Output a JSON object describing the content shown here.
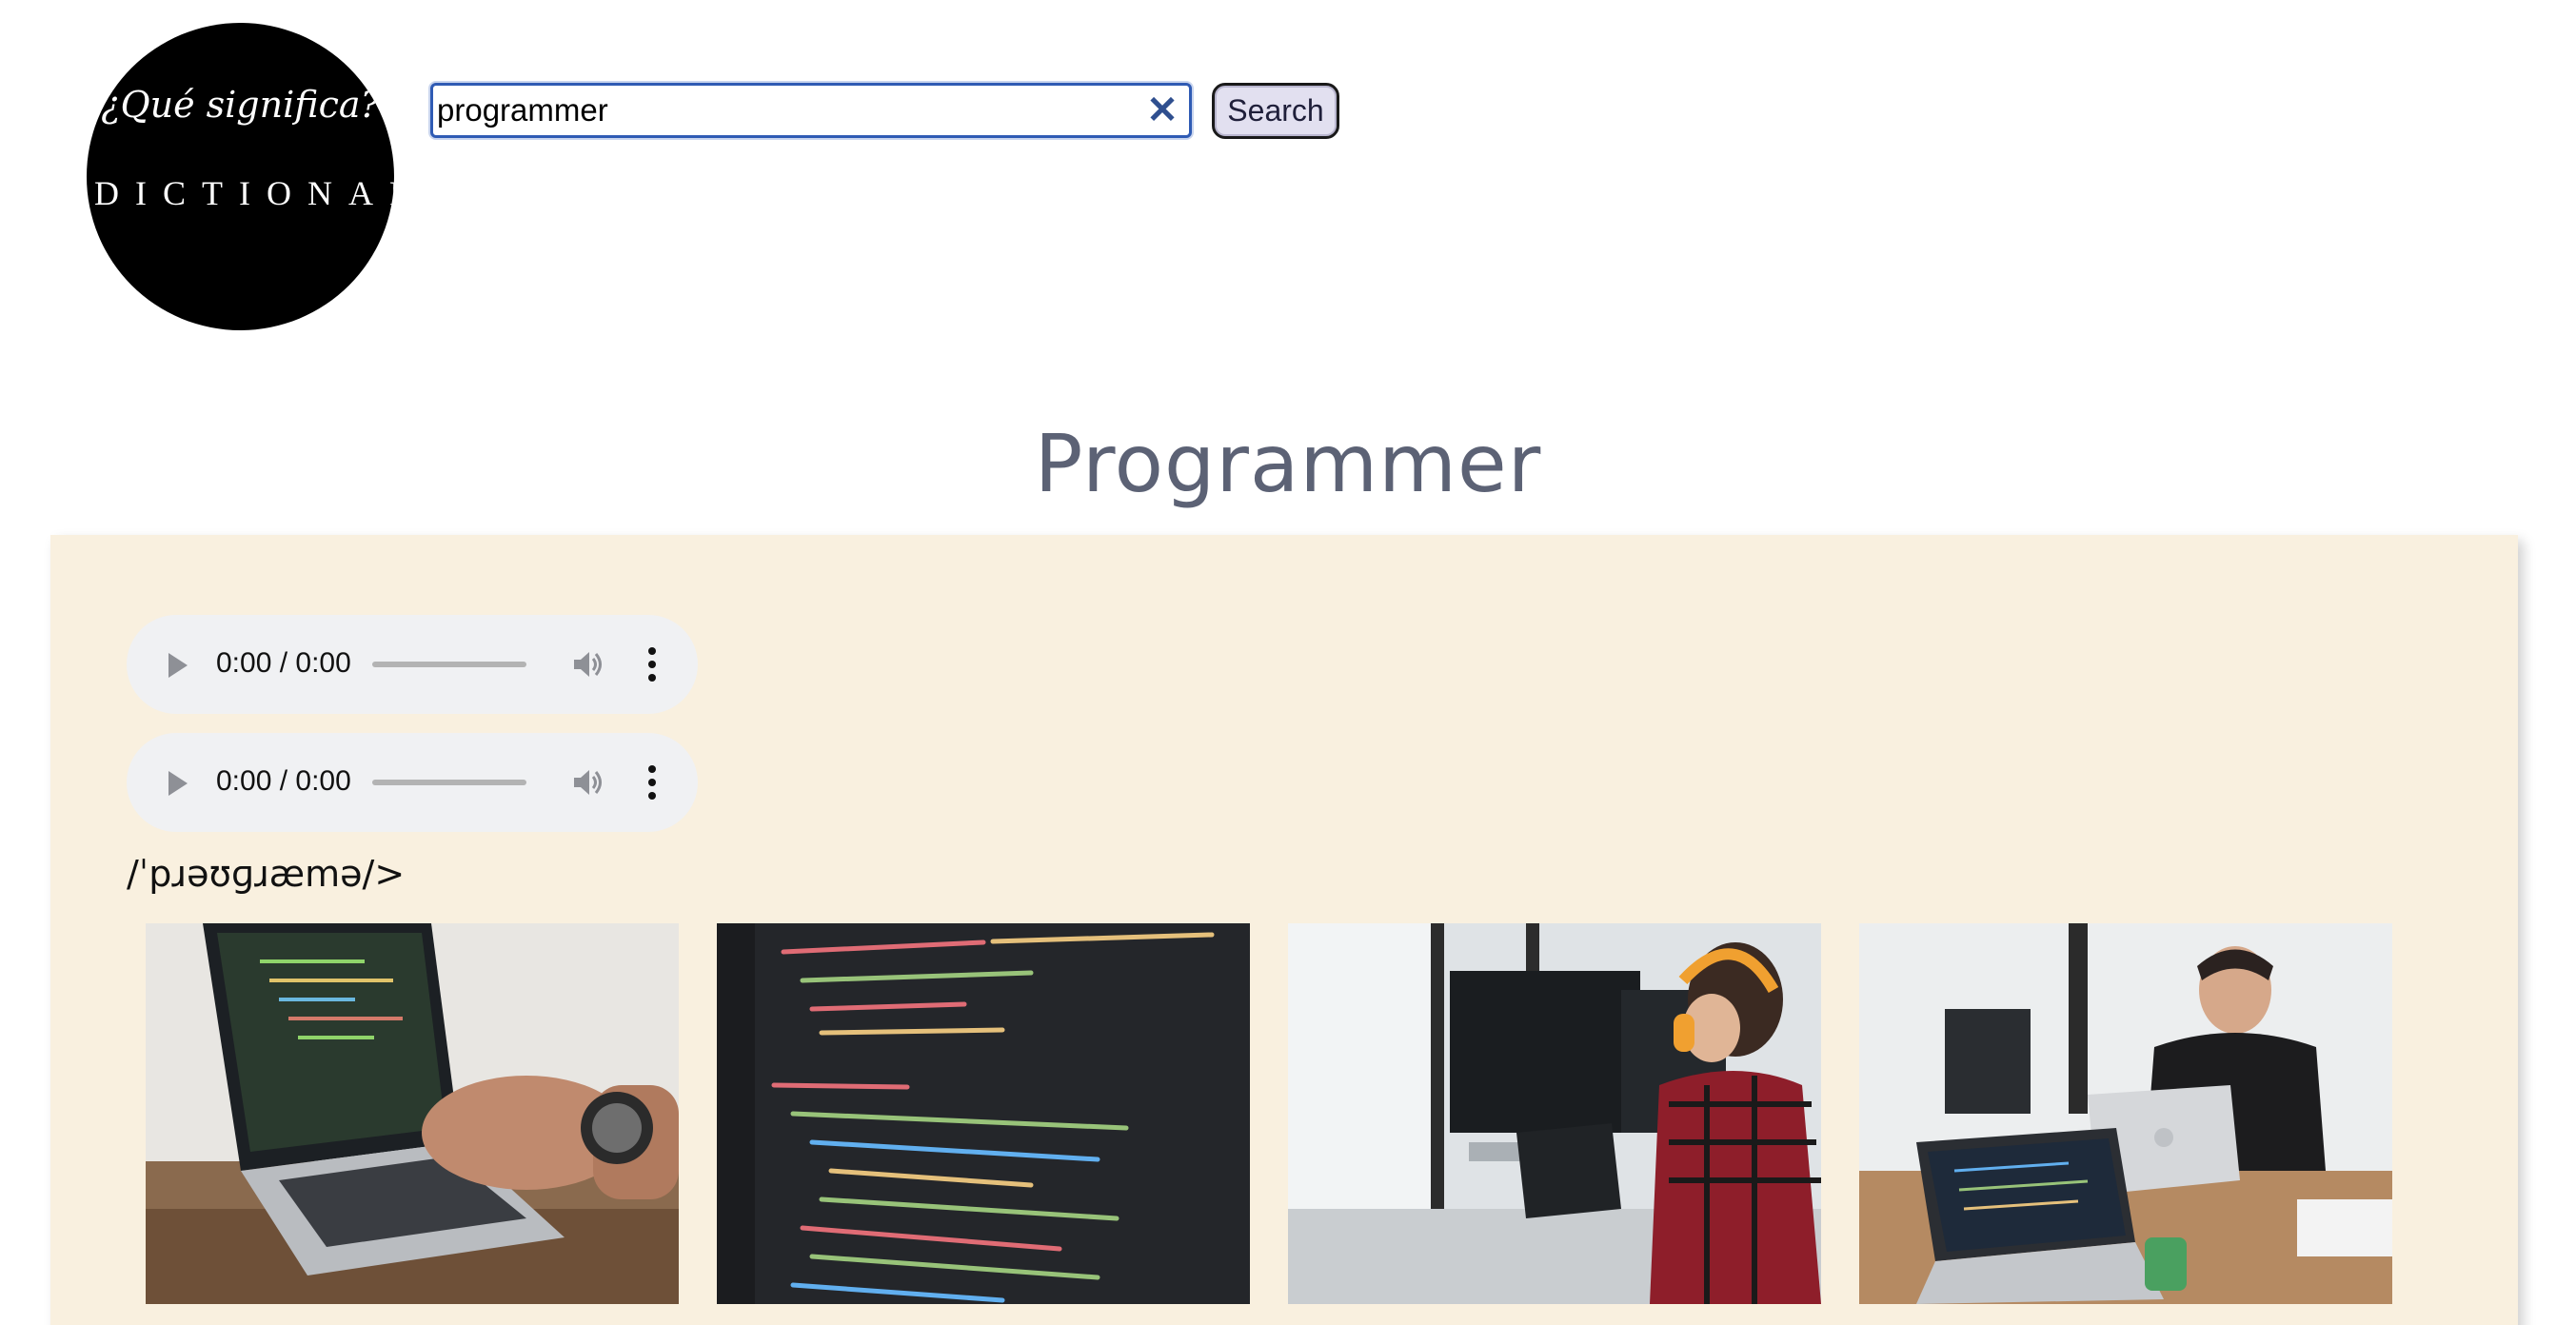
{
  "logo": {
    "tagline": "¿Qué significa?",
    "word": "DICTIONARY"
  },
  "search": {
    "value": "programmer",
    "clear_icon": "close-icon",
    "button_label": "Search"
  },
  "result": {
    "word": "Programmer",
    "audio_players": [
      {
        "time": "0:00 / 0:00",
        "progress": 0
      },
      {
        "time": "0:00 / 0:00",
        "progress": 0
      }
    ],
    "phonetic": "/ˈpɹəʊɡɹæmə/>"
  },
  "images": [
    {
      "subject": "hands typing on laptop with code"
    },
    {
      "subject": "code on dark screen"
    },
    {
      "subject": "woman with headphones at desk computers"
    },
    {
      "subject": "man working on laptops at office table"
    }
  ],
  "colors": {
    "logo_bg": "#000000",
    "title": "#5c6275",
    "card_bg": "#f9f0df",
    "audio_bg": "#f0f1f3",
    "search_border": "#2f5bb4",
    "button_bg": "#e2e0f0"
  }
}
